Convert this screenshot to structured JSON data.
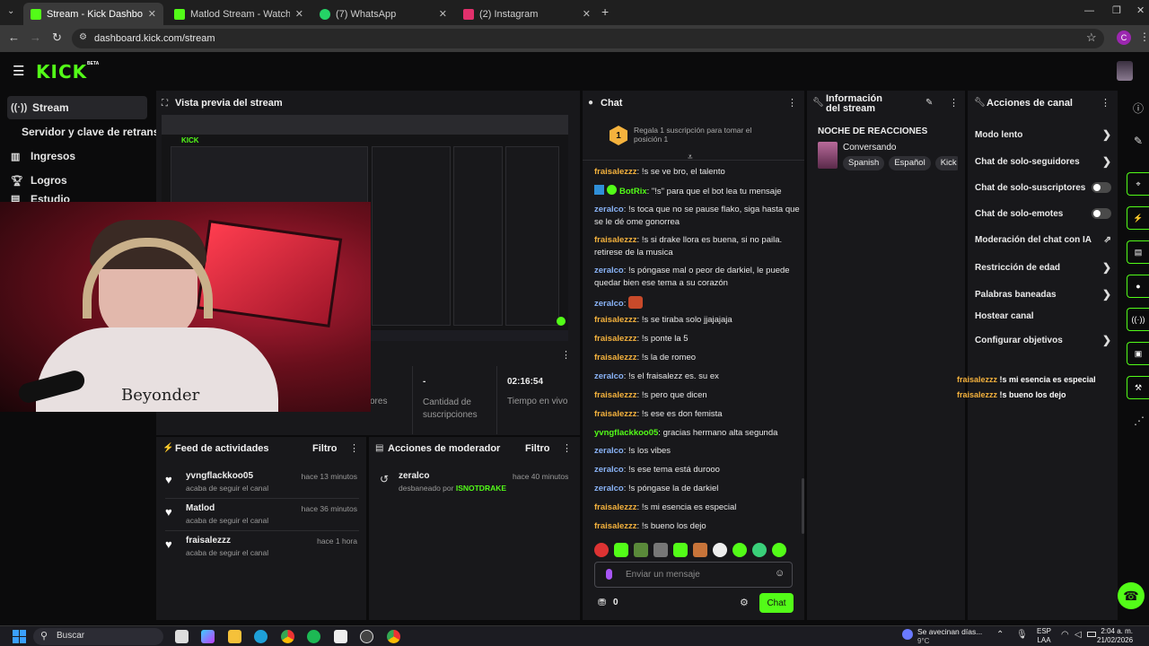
{
  "browser": {
    "tabs": [
      {
        "title": "Stream - Kick Dashboard",
        "color": "#53fc18",
        "active": true
      },
      {
        "title": "Matlod Stream - Watch Live on",
        "color": "#53fc18",
        "active": false
      },
      {
        "title": "(7) WhatsApp",
        "color": "#25d366",
        "active": false
      },
      {
        "title": "(2) Instagram",
        "color": "#e1306c",
        "active": false
      }
    ],
    "url": "dashboard.kick.com/stream",
    "profile_initial": "C"
  },
  "kick": {
    "logo": "KICK",
    "badge": "BETA",
    "sidebar": [
      {
        "label": "Stream",
        "icon": "broadcast-icon"
      },
      {
        "label": "Servidor y clave de retransm",
        "icon": ""
      },
      {
        "label": "Ingresos",
        "icon": "chart-icon"
      },
      {
        "label": "Logros",
        "icon": "trophy-icon"
      },
      {
        "label": "Estudio",
        "icon": "studio-icon"
      }
    ]
  },
  "preview": {
    "title": "Vista previa del stream",
    "stats": [
      {
        "value": "-",
        "label": "Cantidad de suscripciones"
      },
      {
        "value": "02:16:54",
        "label": "Tiempo en vivo"
      }
    ],
    "partial_label": "ores"
  },
  "webcam": {
    "shirt_text": "Beyonder"
  },
  "feed": {
    "title": "Feed de actividades",
    "filter": "Filtro",
    "items": [
      {
        "name": "yvngflackkoo05",
        "action": "acaba de seguir el canal",
        "time": "hace 13 minutos"
      },
      {
        "name": "Matlod",
        "action": "acaba de seguir el canal",
        "time": "hace 36 minutos"
      },
      {
        "name": "fraisalezzz",
        "action": "acaba de seguir el canal",
        "time": "hace 1 hora"
      }
    ]
  },
  "mod_actions": {
    "title": "Acciones de moderador",
    "filter": "Filtro",
    "items": [
      {
        "name": "zeralco",
        "action": "desbaneado por",
        "by": "ISNOTDRAKE",
        "time": "hace 40 minutos"
      }
    ]
  },
  "chat": {
    "title": "Chat",
    "gift_text": "Regala 1 suscripción para tomar el posición 1",
    "gift_rank": "1",
    "messages": [
      {
        "user": "fraisalezzz",
        "color": "o",
        "text": "!s se ve bro, el talento"
      },
      {
        "user": "BotRix",
        "color": "g",
        "text": "\"!s\" para que el bot lea tu mensaje"
      },
      {
        "user": "zeralco",
        "color": "b",
        "text": "!s toca que no se pause flako, siga hasta que se le dé ome gonorrea"
      },
      {
        "user": "fraisalezzz",
        "color": "o",
        "text": "!s si drake llora es buena, si no paila. retirese de la musica"
      },
      {
        "user": "zeralco",
        "color": "b",
        "text": "!s póngase mal o peor de darkiel, le puede quedar bien ese tema a su corazón"
      },
      {
        "user": "zeralco",
        "color": "b",
        "text": ""
      },
      {
        "user": "fraisalezzz",
        "color": "o",
        "text": "!s se tiraba solo jjajajaja"
      },
      {
        "user": "fraisalezzz",
        "color": "o",
        "text": "!s ponte la 5"
      },
      {
        "user": "fraisalezzz",
        "color": "o",
        "text": "!s la de romeo"
      },
      {
        "user": "zeralco",
        "color": "b",
        "text": "!s el fraisalezz es. su ex"
      },
      {
        "user": "fraisalezzz",
        "color": "o",
        "text": "!s pero que dicen"
      },
      {
        "user": "fraisalezzz",
        "color": "o",
        "text": "!s ese es don femista"
      },
      {
        "user": "yvngflackkoo05",
        "color": "g",
        "text": "gracias hermano alta segunda"
      },
      {
        "user": "zeralco",
        "color": "b",
        "text": "!s los vibes"
      },
      {
        "user": "zeralco",
        "color": "b",
        "text": "!s ese tema está durooo"
      },
      {
        "user": "zeralco",
        "color": "b",
        "text": "!s póngase la de darkiel"
      },
      {
        "user": "fraisalezzz",
        "color": "o",
        "text": "!s mi esencia es especial"
      },
      {
        "user": "fraisalezzz",
        "color": "o",
        "text": "!s bueno los dejo"
      }
    ],
    "input_placeholder": "Enviar un mensaje",
    "points": "0",
    "send_label": "Chat"
  },
  "info": {
    "title": "Información del stream",
    "stream_title": "NOCHE DE REACCIONES",
    "category": "Conversando",
    "tags": [
      "Spanish",
      "Español",
      "Kick"
    ]
  },
  "channel_actions": {
    "title": "Acciones de canal",
    "items": [
      {
        "label": "Modo lento",
        "control": "chevron"
      },
      {
        "label": "Chat de solo-seguidores",
        "control": "chevron"
      },
      {
        "label": "Chat de solo-suscriptores",
        "control": "toggle"
      },
      {
        "label": "Chat de solo-emotes",
        "control": "toggle"
      },
      {
        "label": "Moderación del chat con IA",
        "control": "external"
      },
      {
        "label": "Restricción de edad",
        "control": "chevron"
      },
      {
        "label": "Palabras baneadas",
        "control": "chevron"
      },
      {
        "label": "Hostear canal",
        "control": "none"
      },
      {
        "label": "Configurar objetivos",
        "control": "chevron"
      }
    ]
  },
  "overlay_chat": [
    {
      "user": "fraisalezzz",
      "text": "!s mi esencia es especial"
    },
    {
      "user": "fraisalezzz",
      "text": "!s bueno los dejo"
    }
  ],
  "taskbar": {
    "search": "Buscar",
    "weather_text": "Se avecinan días...",
    "weather_temp": "9°C",
    "lang_top": "ESP",
    "lang_bottom": "LAA",
    "time": "2:04 a. m.",
    "date": "21/02/2026"
  }
}
